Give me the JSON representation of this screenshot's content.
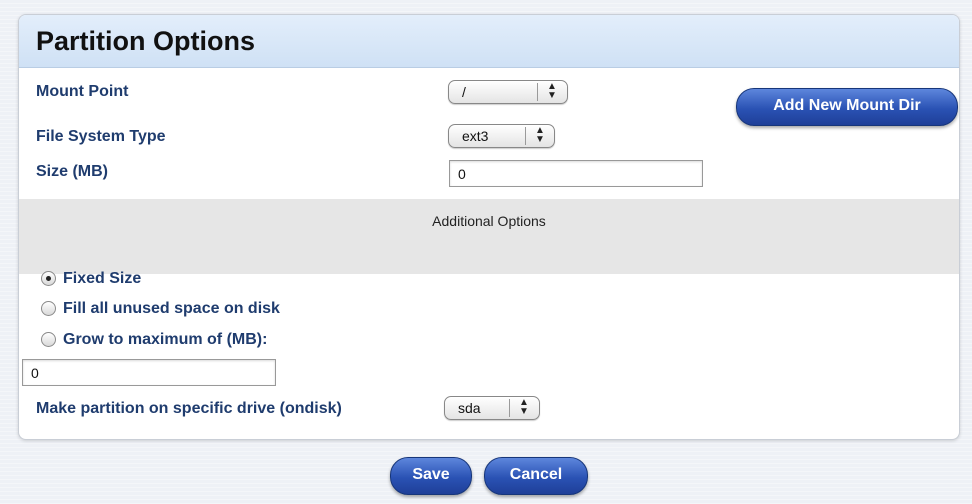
{
  "panel": {
    "title": "Partition Options"
  },
  "form": {
    "mount_point_label": "Mount Point",
    "mount_point_value": "/",
    "add_mount_dir_label": "Add New Mount Dir",
    "fs_type_label": "File System Type",
    "fs_type_value": "ext3",
    "size_label": "Size (MB)",
    "size_value": "0",
    "additional_options_label": "Additional Options",
    "size_options": [
      {
        "label": "Fixed Size",
        "selected": true
      },
      {
        "label": "Fill all unused space on disk",
        "selected": false
      },
      {
        "label": "Grow to maximum of (MB):",
        "selected": false
      }
    ],
    "grow_max_value": "0",
    "ondisk_label": "Make partition on specific drive (ondisk)",
    "ondisk_value": "sda"
  },
  "actions": {
    "save_label": "Save",
    "cancel_label": "Cancel"
  },
  "colors": {
    "label_text": "#1f3c6e",
    "button_blue": "#2a52b4",
    "header_bg": "#d8e7f8",
    "options_band": "#e6e6e6"
  }
}
